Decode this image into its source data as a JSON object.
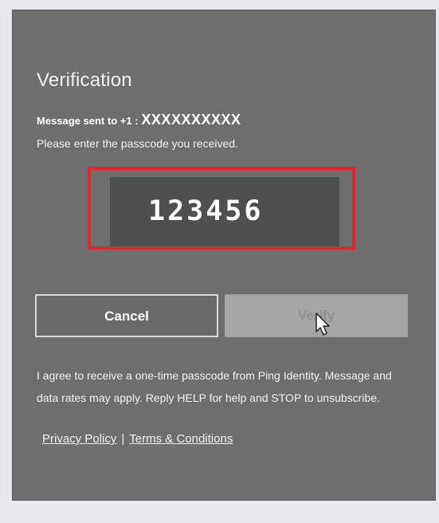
{
  "dialog": {
    "title": "Verification",
    "message_label": "Message sent to +1 :",
    "phone_masked": "XXXXXXXXXX",
    "instruction": "Please enter the passcode you received.",
    "passcode_value": "123456",
    "buttons": {
      "cancel": "Cancel",
      "verify": "Verify"
    },
    "legal_text": "I agree to receive a one-time passcode from Ping Identity. Message and data rates may apply. Reply HELP for help and STOP to unsubscribe.",
    "links": {
      "privacy": "Privacy Policy",
      "separator": "|",
      "terms": "Terms & Conditions"
    }
  },
  "colors": {
    "dialog_bg": "#6e6e6e",
    "highlight_outline": "#e0262e",
    "input_bg": "#4f4f4f",
    "verify_disabled_bg": "#a6a6a6"
  },
  "icons": {
    "pointer": "mouse-cursor-icon"
  }
}
